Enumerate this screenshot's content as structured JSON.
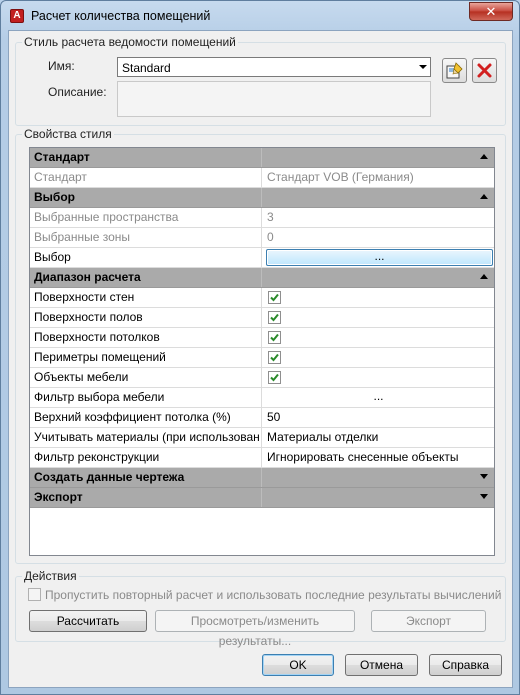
{
  "window": {
    "title": "Расчет количества помещений",
    "close_glyph": "✕"
  },
  "style_group": {
    "title": "Стиль расчета ведомости помещений",
    "name_label": "Имя:",
    "name_value": "Standard",
    "description_label": "Описание:",
    "description_value": ""
  },
  "properties": {
    "title": "Свойства стиля",
    "rows": [
      {
        "type": "category",
        "name": "Стандарт",
        "toggle": "collapse"
      },
      {
        "type": "text",
        "name": "Стандарт",
        "value": "Стандарт VOB (Германия)",
        "disabled": true
      },
      {
        "type": "category",
        "name": "Выбор",
        "toggle": "collapse"
      },
      {
        "type": "text",
        "name": "Выбранные пространства",
        "value": "3",
        "disabled": true
      },
      {
        "type": "text",
        "name": "Выбранные зоны",
        "value": "0",
        "disabled": true
      },
      {
        "type": "button",
        "name": "Выбор",
        "value": "...",
        "focused": true
      },
      {
        "type": "category",
        "name": "Диапазон расчета",
        "toggle": "collapse"
      },
      {
        "type": "check",
        "name": "Поверхности стен",
        "checked": true
      },
      {
        "type": "check",
        "name": "Поверхности полов",
        "checked": true
      },
      {
        "type": "check",
        "name": "Поверхности потолков",
        "checked": true
      },
      {
        "type": "check",
        "name": "Периметры помещений",
        "checked": true
      },
      {
        "type": "check",
        "name": "Объекты мебели",
        "checked": true
      },
      {
        "type": "button",
        "name": "Фильтр выбора мебели",
        "value": "...",
        "focused": false
      },
      {
        "type": "text",
        "name": "Верхний коэффициент потолка (%)",
        "value": "50"
      },
      {
        "type": "text",
        "name": "Учитывать материалы (при использован",
        "value": "Материалы отделки"
      },
      {
        "type": "text",
        "name": "Фильтр реконструкции",
        "value": "Игнорировать снесенные объекты"
      },
      {
        "type": "category",
        "name": "Создать данные чертежа",
        "toggle": "expand"
      },
      {
        "type": "category",
        "name": "Экспорт",
        "toggle": "expand"
      }
    ]
  },
  "actions": {
    "title": "Действия",
    "skip_label": "Пропустить повторный расчет и использовать последние результаты вычислений",
    "calculate": "Рассчитать",
    "view_edit": "Просмотреть/изменить результаты...",
    "export": "Экспорт"
  },
  "footer": {
    "ok": "OK",
    "cancel": "Отмена",
    "help": "Справка"
  },
  "colors": {
    "category_bg": "#aaaaaa",
    "check_green": "#2a8a2a",
    "delete_red": "#d22020"
  }
}
